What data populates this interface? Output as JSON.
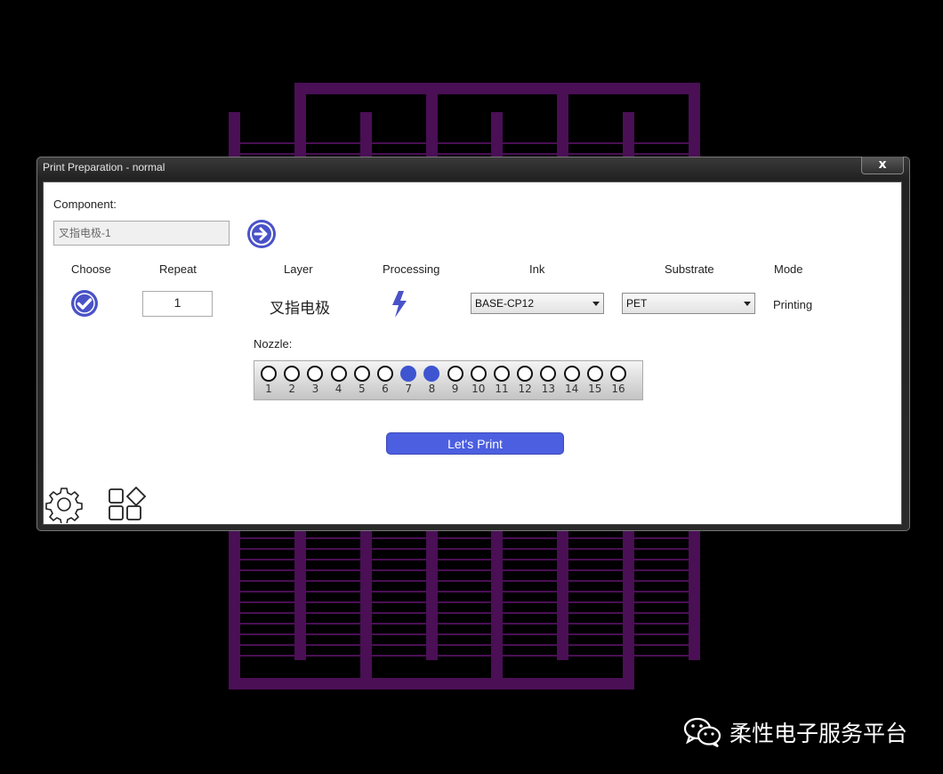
{
  "window": {
    "title": "Print Preparation - normal",
    "close_label": "x"
  },
  "component": {
    "label": "Component:",
    "value": "叉指电极-1",
    "go_icon": "arrow-right-circle-icon"
  },
  "headers": {
    "choose": "Choose",
    "repeat": "Repeat",
    "layer": "Layer",
    "processing": "Processing",
    "ink": "Ink",
    "substrate": "Substrate",
    "mode": "Mode"
  },
  "row": {
    "choose_checked": true,
    "repeat_value": "1",
    "layer_name": "叉指电极",
    "processing_icon": "lightning-bolt-icon",
    "ink": "BASE-CP12",
    "substrate": "PET",
    "mode": "Printing"
  },
  "nozzle": {
    "label": "Nozzle:",
    "items": [
      {
        "num": "1",
        "on": false
      },
      {
        "num": "2",
        "on": false
      },
      {
        "num": "3",
        "on": false
      },
      {
        "num": "4",
        "on": false
      },
      {
        "num": "5",
        "on": false
      },
      {
        "num": "6",
        "on": false
      },
      {
        "num": "7",
        "on": true
      },
      {
        "num": "8",
        "on": true
      },
      {
        "num": "9",
        "on": false
      },
      {
        "num": "10",
        "on": false
      },
      {
        "num": "11",
        "on": false
      },
      {
        "num": "12",
        "on": false
      },
      {
        "num": "13",
        "on": false
      },
      {
        "num": "14",
        "on": false
      },
      {
        "num": "15",
        "on": false
      },
      {
        "num": "16",
        "on": false
      }
    ]
  },
  "actions": {
    "print_label": "Let's Print"
  },
  "footer_icons": [
    "gear-icon",
    "apps-grid-icon"
  ],
  "watermark": {
    "text": "柔性电子服务平台",
    "icon": "wechat-icon"
  },
  "colors": {
    "accent": "#4a52c8",
    "nozzle_on": "#3e54d0",
    "electrode": "#4a0f55",
    "background": "#000000"
  }
}
